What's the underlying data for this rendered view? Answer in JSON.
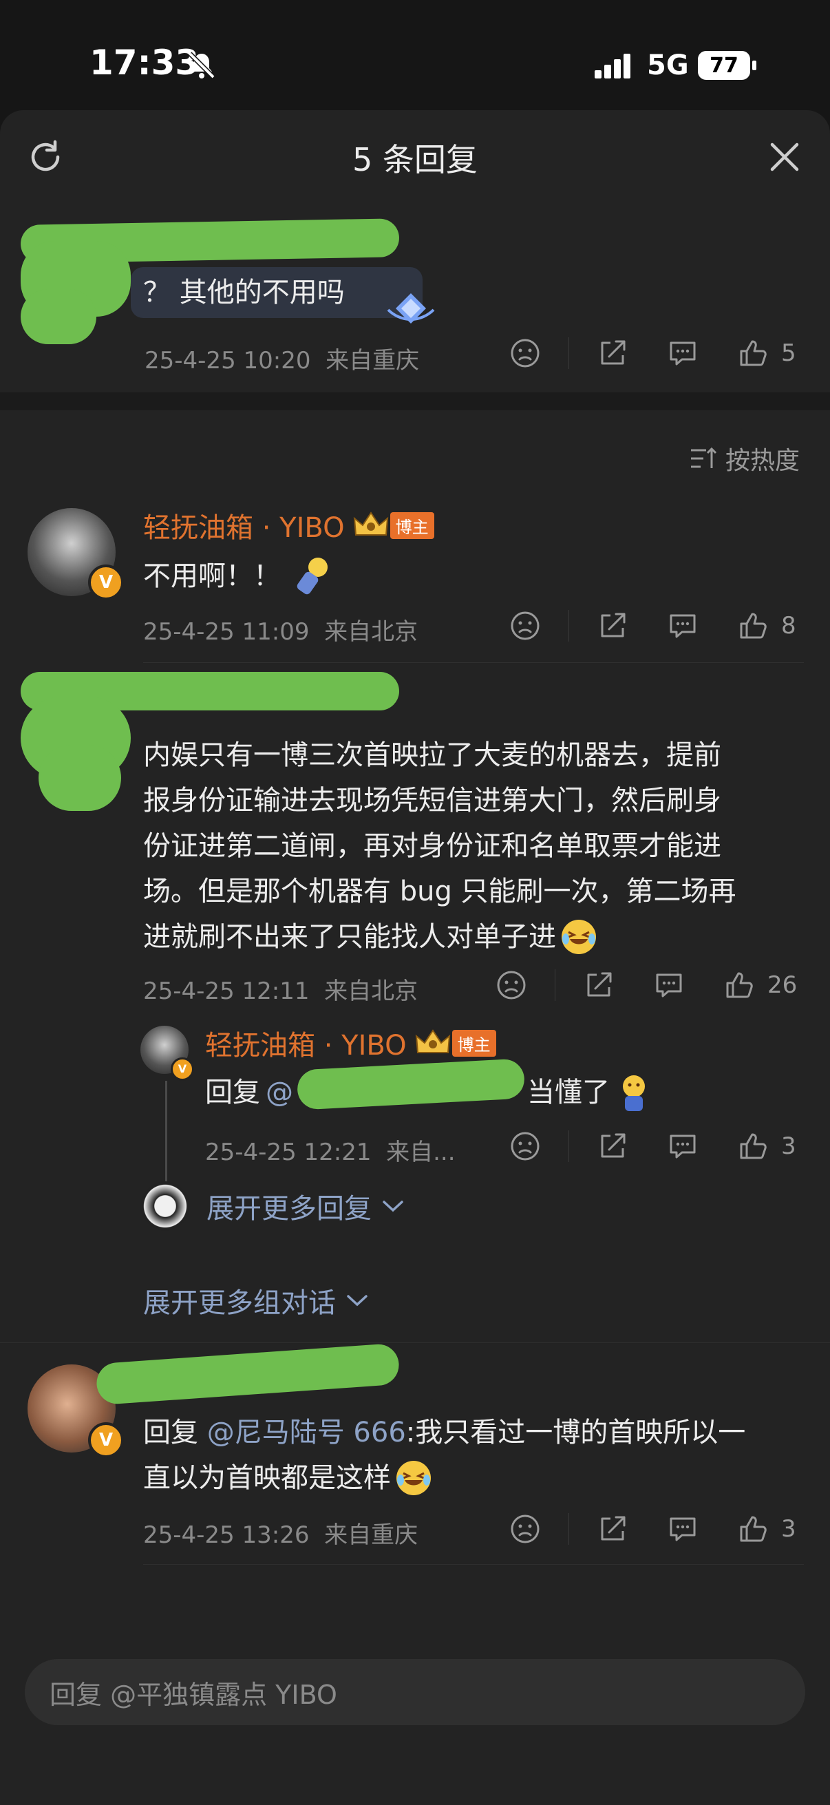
{
  "status": {
    "time": "17:33",
    "network": "5G",
    "battery": "77"
  },
  "header": {
    "title": "5 条回复"
  },
  "main_comment": {
    "text": "？ 其他的不用吗",
    "date": "25-4-25 10:20",
    "location": "来自重庆",
    "likes": "5"
  },
  "sort_label": "按热度",
  "comments": [
    {
      "username": "轻抚油箱 · YIBO",
      "badge": "博主",
      "text": "不用啊！！",
      "date": "25-4-25 11:09",
      "location": "来自北京",
      "likes": "8"
    },
    {
      "text_lines": [
        "内娱只有一博三次首映拉了大麦的机器去，提前",
        "报身份证输进去现场凭短信进第大门，然后刷身",
        "份证进第二道闸，再对身份证和名单取票才能进",
        "场。但是那个机器有 bug 只能刷一次，第二场再",
        "进就刷不出来了只能找人对单子进"
      ],
      "date": "25-4-25 12:11",
      "location": "来自北京",
      "likes": "26"
    },
    {
      "username": "轻抚油箱 · YIBO",
      "badge": "博主",
      "reply_prefix": "回复",
      "mention_start": "@",
      "text_end": "当懂了",
      "date": "25-4-25 12:21",
      "location": "来自...",
      "likes": "3"
    },
    {
      "reply_prefix": "回复",
      "mention": "@尼马陆号 666",
      "text_lines": [
        ":我只看过一博的首映所以一",
        "直以为首映都是这样"
      ],
      "date": "25-4-25 13:26",
      "location": "来自重庆",
      "likes": "3"
    }
  ],
  "expand_replies": "展开更多回复",
  "expand_groups": "展开更多组对话",
  "input": {
    "placeholder": "回复 @平独镇露点 YIBO"
  },
  "colors": {
    "accent": "#e0732f",
    "background": "#232323",
    "mention": "#8ea3c7"
  }
}
